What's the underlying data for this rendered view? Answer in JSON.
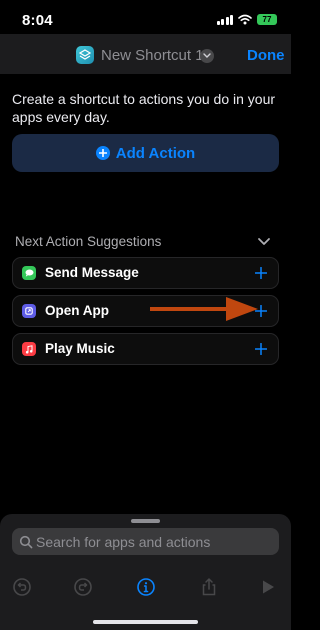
{
  "status_bar": {
    "time": "8:04",
    "battery": "77"
  },
  "nav": {
    "title": "New Shortcut 1",
    "done_label": "Done",
    "app_icon": "shortcuts-app-icon"
  },
  "intro_text": "Create a shortcut to actions you do in your apps every day.",
  "add_action": {
    "label": "Add Action",
    "icon": "plus-circle-icon"
  },
  "suggestions": {
    "title": "Next Action Suggestions",
    "items": [
      {
        "label": "Send Message",
        "icon": "messages-icon",
        "color": "#34c759"
      },
      {
        "label": "Open App",
        "icon": "open-app-icon",
        "color": "#5e5ce6"
      },
      {
        "label": "Play Music",
        "icon": "music-icon",
        "color": "#fc3c44"
      }
    ]
  },
  "annotation": {
    "arrow_color": "#c0470f",
    "pointing_to": "open-app-add-button"
  },
  "search": {
    "placeholder": "Search for apps and actions"
  },
  "toolbar": {
    "items": [
      "undo-icon",
      "redo-icon",
      "info-icon",
      "share-icon",
      "play-icon"
    ]
  },
  "colors": {
    "accent": "#0a84ff",
    "background": "#000000",
    "panel": "#1c1c1e"
  }
}
